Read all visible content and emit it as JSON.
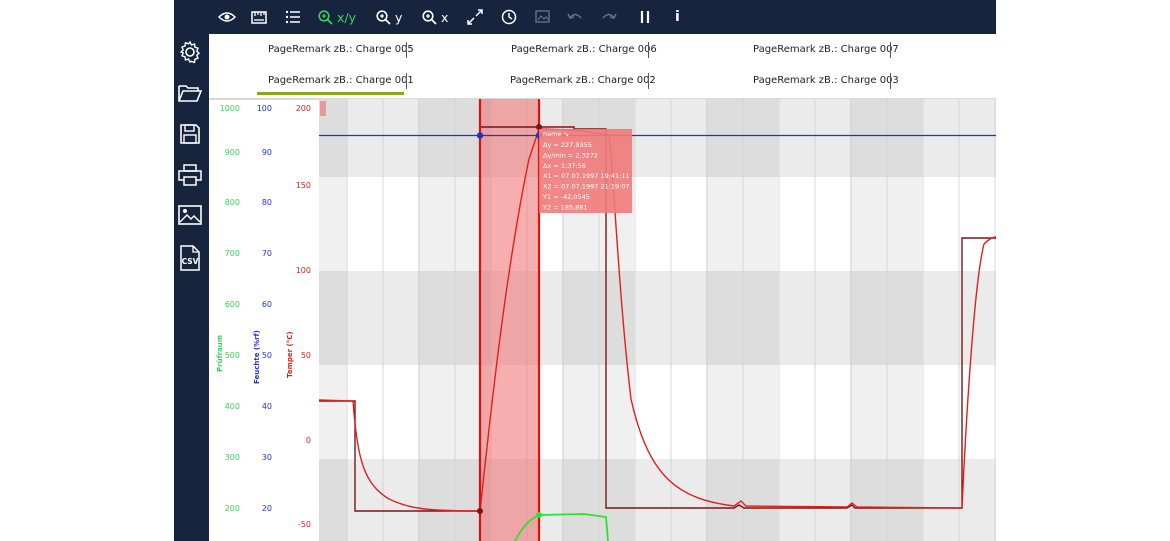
{
  "toolbar": {
    "zoom_xy_label": "x/y",
    "zoom_y_label": "y",
    "zoom_x_label": "x",
    "info_label": "i",
    "pause_label": "II"
  },
  "sidebar": {
    "items": [
      "settings-icon",
      "folder-open-icon",
      "save-icon",
      "print-icon",
      "image-icon",
      "csv-icon"
    ],
    "csv_label": "CSV"
  },
  "tabs": {
    "row1": [
      "PageRemark zB.: Charge 005",
      "PageRemark zB.: Charge 006",
      "PageRemark zB.: Charge 007"
    ],
    "row2": [
      "PageRemark zB.: Charge 001",
      "PageRemark zB.: Charge 002",
      "PageRemark zB.: Charge 003"
    ],
    "active": "PageRemark zB.: Charge 001",
    "active_color": "#8fa51e"
  },
  "axes": {
    "prufraum": {
      "name": "Prüfraum",
      "color": "#3cd25a",
      "ticks": [
        "1000",
        "900",
        "800",
        "700",
        "600",
        "500",
        "400",
        "300",
        "200"
      ]
    },
    "feuchte": {
      "name": "Feuchte (%rf)",
      "color": "#2233cc",
      "ticks": [
        "100",
        "90",
        "80",
        "70",
        "60",
        "50",
        "40",
        "30",
        "20"
      ]
    },
    "temper": {
      "name": "Temper (°C)",
      "color": "#e02020",
      "ticks": [
        "200",
        "150",
        "100",
        "50",
        "0",
        "-50"
      ]
    }
  },
  "cursor_box": {
    "title": "name ↘",
    "lines": [
      "Δy = 227,9355",
      "Δy/min = 2,3272",
      "Δx = 1:37:56",
      "X1 = 07.07.1997 19:41:11",
      "X2 = 07.07.1997 21:19:07",
      "Y1 = -42,0545",
      "Y2 = 185,881"
    ]
  },
  "colors": {
    "navy": "#16253d",
    "temp_line": "#e02020",
    "setpoint_line": "#7a1414",
    "humidity_line": "#2233cc",
    "test_room_line": "#30e030",
    "cursor_fill": "#f06b6b"
  }
}
